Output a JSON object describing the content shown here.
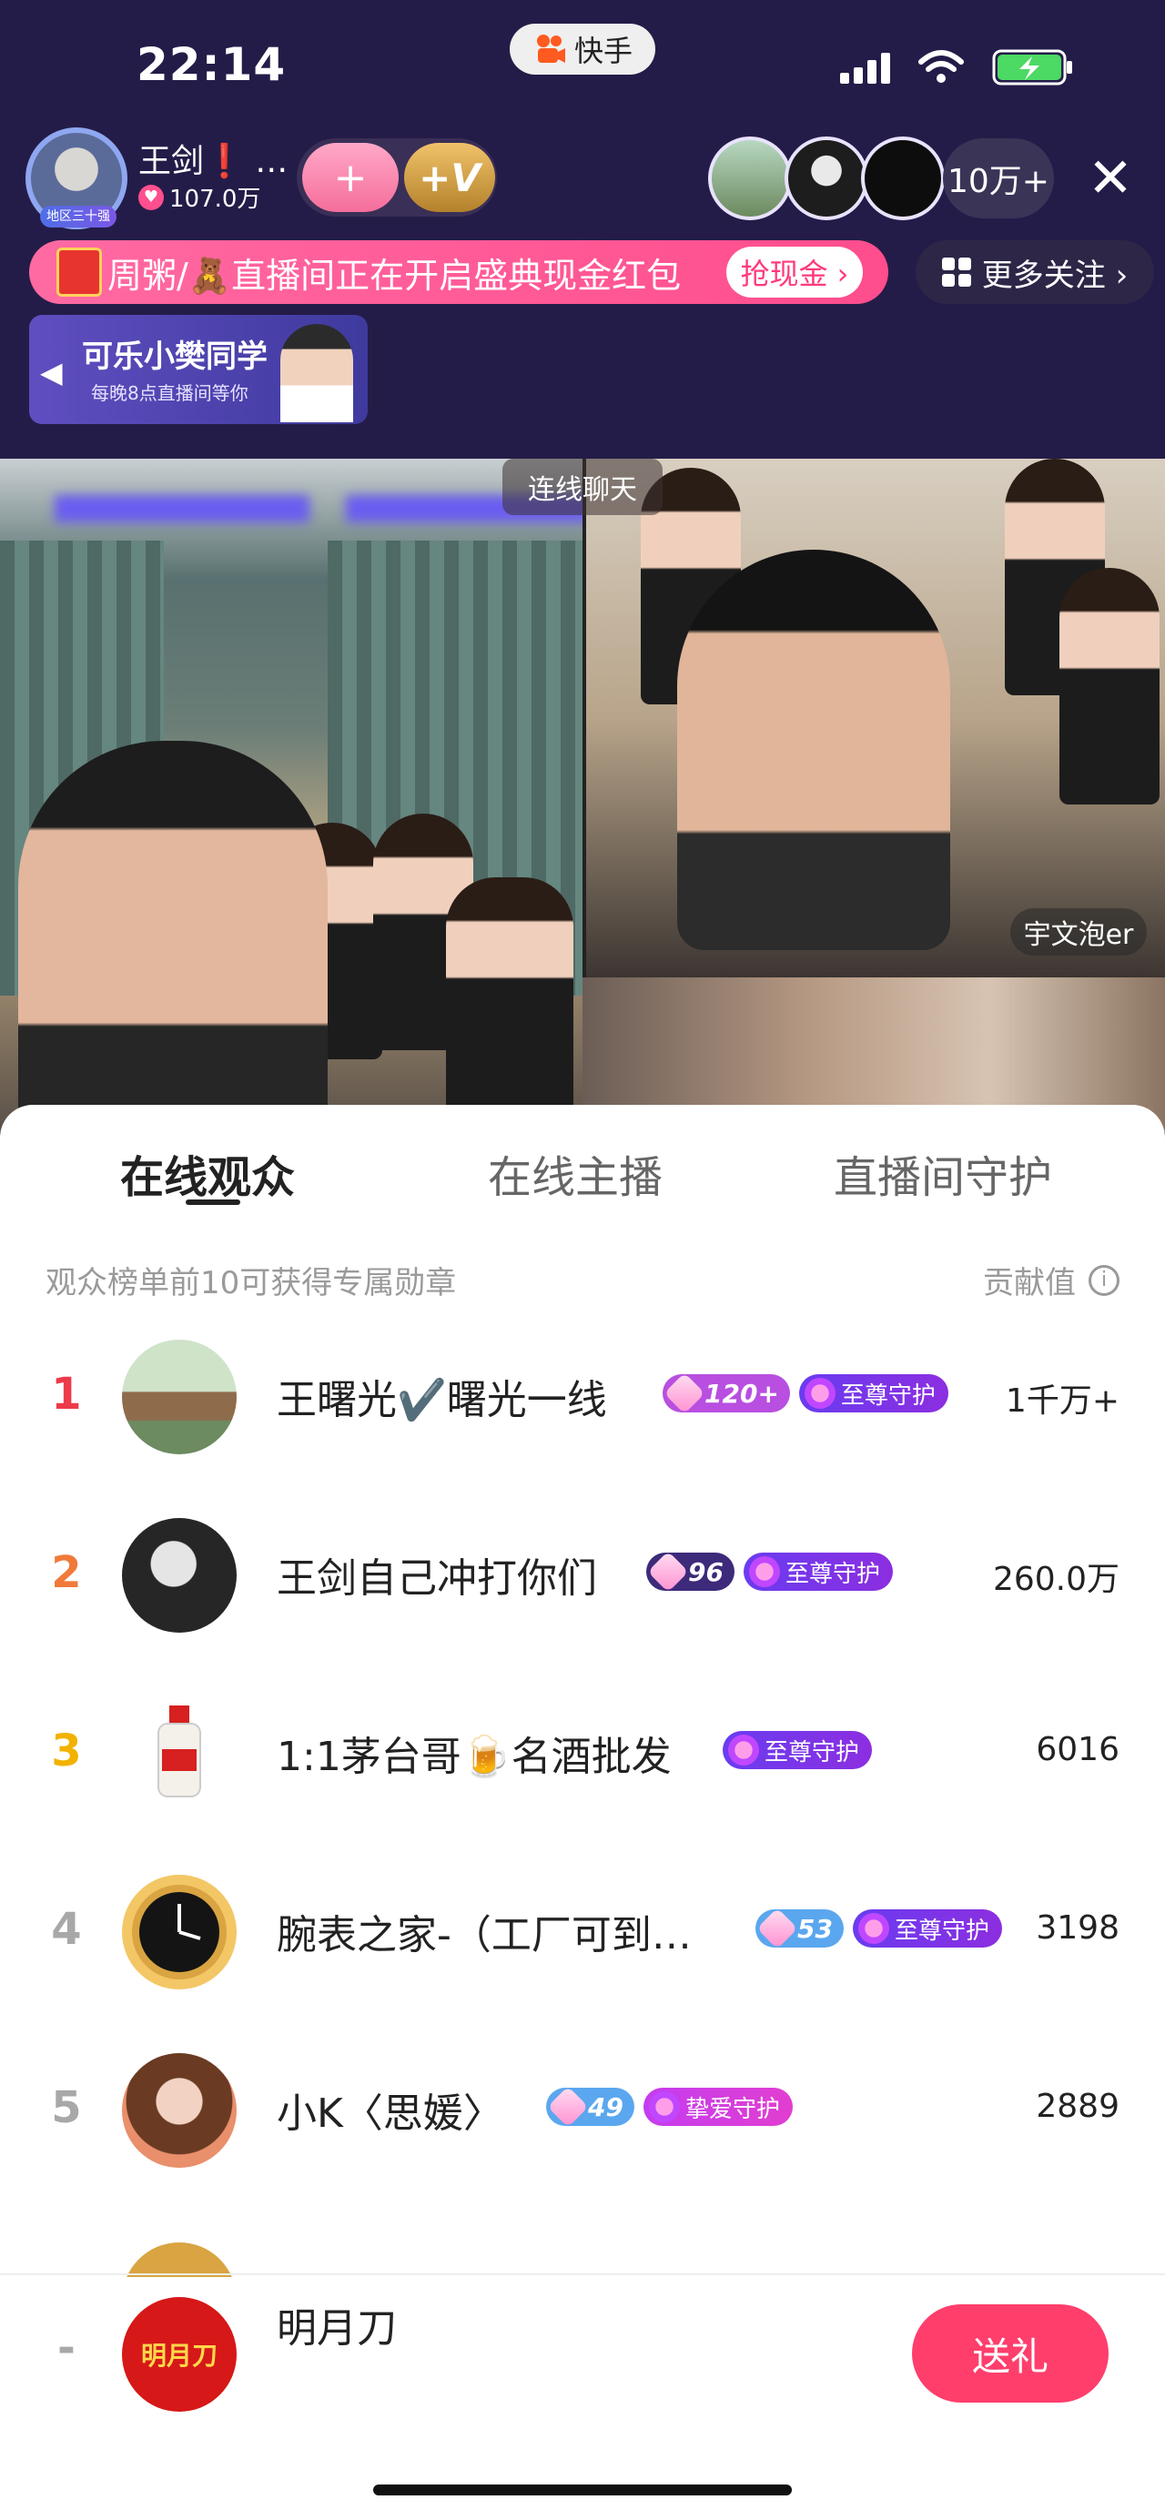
{
  "status_bar": {
    "time": "22:14",
    "app_name": "快手",
    "icons": [
      "signal-icon",
      "wifi-icon",
      "battery-charging-icon"
    ]
  },
  "header": {
    "anchor_name": "王剑❗ …",
    "anchor_likes": "107.0万",
    "anchor_badge": "地区三十强",
    "follow_symbol": "+",
    "vip_symbol": "+V",
    "viewer_count": "10万+",
    "close_symbol": "✕"
  },
  "banner": {
    "text": "周粥/🧸直播间正在开启盛典现金红包",
    "cta": "抢现金 ›",
    "more_follow": "更多关注 ›"
  },
  "promo": {
    "title": "可乐小樊同学",
    "subtitle": "每晚8点直播间等你"
  },
  "video": {
    "chat_label": "连线聊天",
    "guest_name": "宇文泡er"
  },
  "sheet": {
    "tabs": [
      "在线观众",
      "在线主播",
      "直播间守护"
    ],
    "active_tab": "在线观众",
    "hint": "观众榜单前10可获得专属勋章",
    "contribution_label": "贡献值",
    "rows": [
      {
        "rank": "1",
        "name": "王曙光✔️曙光一线",
        "level": "120+",
        "guard": "至尊守护",
        "score": "1千万+",
        "rank_color": "#ec3b4a",
        "level_color": "#b84fe0"
      },
      {
        "rank": "2",
        "name": "王剑自己冲打你们",
        "level": "96",
        "guard": "至尊守护",
        "score": "260.0万",
        "rank_color": "#f07a3a",
        "level_color": "#8f46d8"
      },
      {
        "rank": "3",
        "name": "1:1茅台哥🍺名酒批发",
        "level": "",
        "guard": "至尊守护",
        "score": "6016",
        "rank_color": "#f2b200",
        "level_color": ""
      },
      {
        "rank": "4",
        "name": "腕表之家-（工厂可到…",
        "level": "53",
        "guard": "至尊守护",
        "score": "3198",
        "rank_color": "#a8a8a8",
        "level_color": "#5aa7ef"
      },
      {
        "rank": "5",
        "name": "小K〈思媛〉",
        "level": "49",
        "guard": "挚爱守护",
        "score": "2889",
        "rank_color": "#a8a8a8",
        "level_color": "#5aa7ef"
      }
    ],
    "me": {
      "rank": "-",
      "name": "明月刀",
      "avatar_text": "明月刀",
      "gift_button": "送礼"
    }
  },
  "colors": {
    "brand_pink": "#ff3e6c",
    "header_bg": "#241c48"
  }
}
